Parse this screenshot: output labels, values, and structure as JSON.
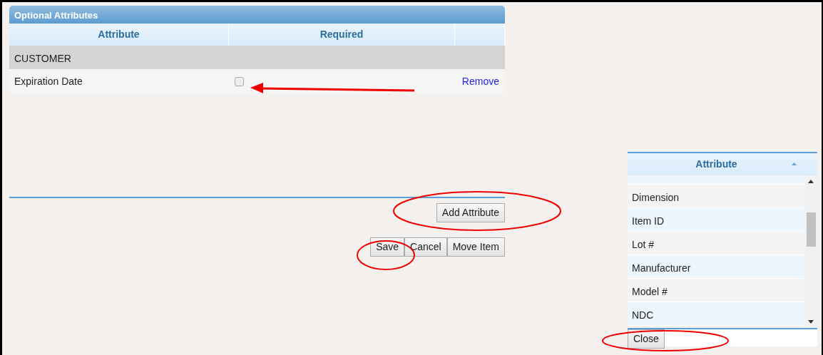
{
  "attributes_panel": {
    "title": "Optional Attributes",
    "columns": [
      "Attribute",
      "Required"
    ],
    "groups": [
      {
        "label": "CUSTOMER",
        "rows": [
          {
            "attribute": "Expiration Date",
            "required": false,
            "action": "Remove"
          }
        ]
      }
    ],
    "add_button": "Add Attribute"
  },
  "form_buttons": [
    "Save",
    "Cancel",
    "Move Item"
  ],
  "picker": {
    "column": "Attribute",
    "rows": [
      "Dimension",
      "Item ID",
      "Lot #",
      "Manufacturer",
      "Model #",
      "NDC"
    ],
    "close_button": "Close"
  }
}
